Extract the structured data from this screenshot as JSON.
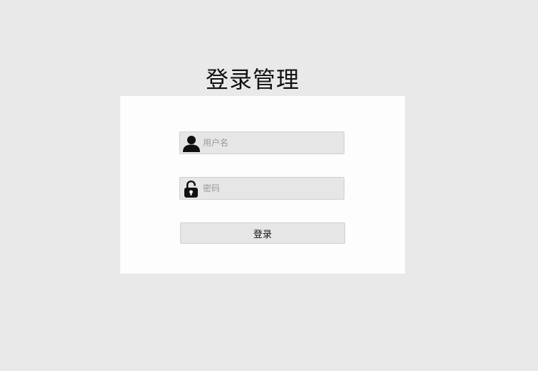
{
  "page": {
    "title": "登录管理"
  },
  "form": {
    "username": {
      "placeholder": "用户名",
      "value": "",
      "icon": "user-icon"
    },
    "password": {
      "placeholder": "密码",
      "value": "",
      "icon": "lock-icon"
    },
    "submit_label": "登录"
  },
  "colors": {
    "page_background": "#e9e9e9",
    "panel_background": "#fdfdfd",
    "field_background": "#e6e6e6",
    "field_border": "#cfcfcf"
  }
}
